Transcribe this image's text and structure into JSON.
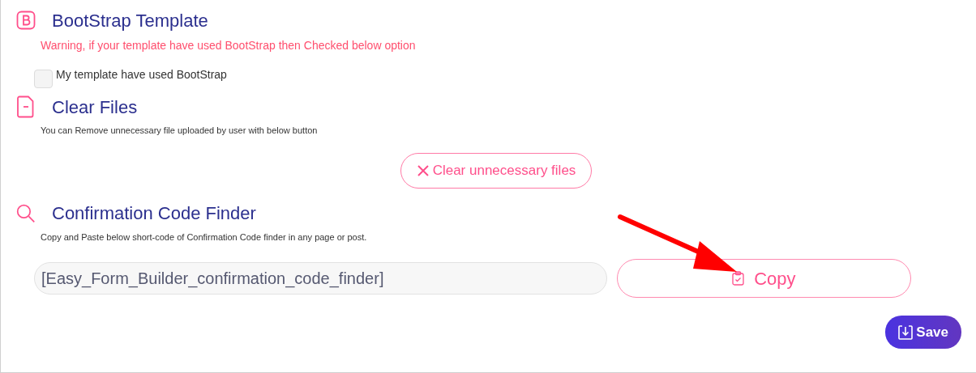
{
  "bootstrap": {
    "title": "BootStrap Template",
    "warning": "Warning, if your template have used BootStrap then Checked below option",
    "checkbox": {
      "label": "My template have used BootStrap",
      "checked": false
    }
  },
  "clear_files": {
    "title": "Clear Files",
    "description": "You can Remove unnecessary file uploaded by user with below button",
    "button": "Clear unnecessary files"
  },
  "finder": {
    "title": "Confirmation Code Finder",
    "description": "Copy and Paste below short-code of Confirmation Code finder in any page or post.",
    "shortcode": "[Easy_Form_Builder_confirmation_code_finder]",
    "copy_button": "Copy"
  },
  "save_button": "Save"
}
